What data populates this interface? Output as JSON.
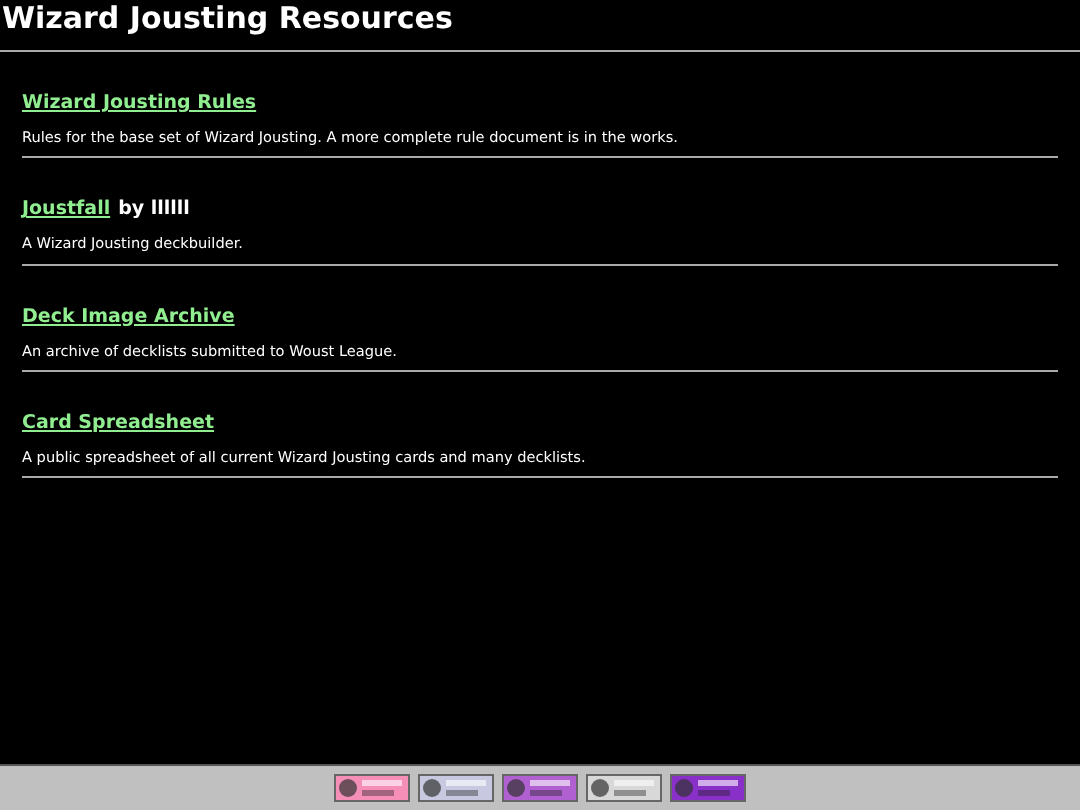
{
  "page_title": "Wizard Jousting Resources",
  "resources": [
    {
      "link": "Wizard Jousting Rules",
      "description": "Rules for the base set of Wizard Jousting. A more complete rule document is in the works."
    },
    {
      "link": "Joustfall",
      "byline": "by llllll",
      "description": "A Wizard Jousting deckbuilder."
    },
    {
      "link": "Deck Image Archive",
      "description": "An archive of decklists submitted to Woust League."
    },
    {
      "link": "Card Spreadsheet",
      "description": "A public spreadsheet of all current Wizard Jousting cards and many decklists."
    }
  ]
}
